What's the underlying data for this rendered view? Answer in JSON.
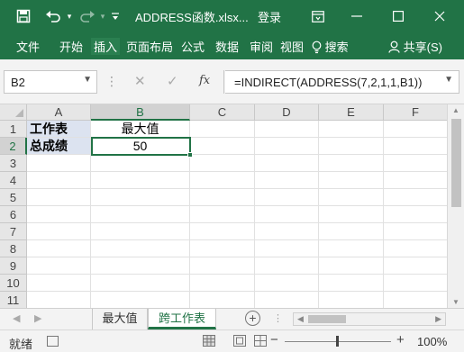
{
  "titlebar": {
    "save_icon": "save-icon",
    "undo_icon": "undo-icon",
    "redo_icon": "redo-icon",
    "customize_icon": "customize-quick-access-icon",
    "title": "ADDRESS函数.xlsx...",
    "login": "登录",
    "window_controls": [
      "ribbon-display-options-icon",
      "minimize-icon",
      "restore-icon",
      "close-icon"
    ]
  },
  "ribbon": {
    "tabs": [
      "文件",
      "开始",
      "插入",
      "页面布局",
      "公式",
      "数据",
      "审阅",
      "视图"
    ],
    "search_label": "搜索",
    "share_label": "共享(S)"
  },
  "formula_bar": {
    "name_box": "B2",
    "formula": "=INDIRECT(ADDRESS(7,2,1,1,B1))",
    "fx": "fx"
  },
  "grid": {
    "columns": [
      "A",
      "B",
      "C",
      "D",
      "E",
      "F"
    ],
    "rows": [
      "1",
      "2",
      "3",
      "4",
      "5",
      "6",
      "7",
      "8",
      "9",
      "10",
      "11"
    ],
    "cells": {
      "A1": "工作表",
      "A2": "总成绩",
      "B1": "最大值",
      "B2": "50"
    },
    "selected_cell": "B2"
  },
  "sheets": {
    "tabs": [
      "最大值",
      "跨工作表"
    ],
    "active": "跨工作表"
  },
  "status": {
    "ready": "就绪",
    "zoom": "100%"
  },
  "colors": {
    "accent": "#217346",
    "header_bg": "#e6e6e6",
    "label_shade": "#dce3f0"
  }
}
